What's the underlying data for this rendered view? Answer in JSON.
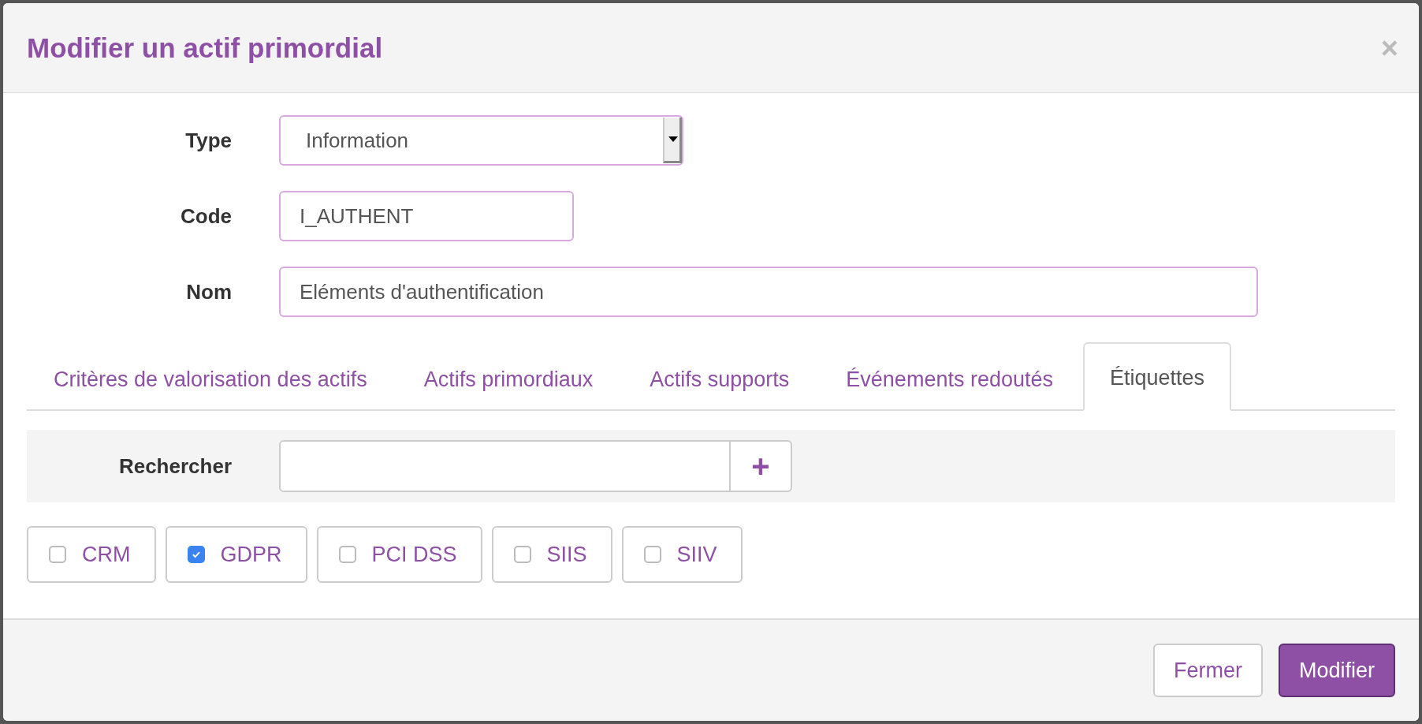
{
  "dialog": {
    "title": "Modifier un actif primordial",
    "close": "×"
  },
  "form": [
    {
      "kind": "select",
      "label": "Type",
      "value": "Information"
    },
    {
      "kind": "short",
      "label": "Code",
      "value": "I_AUTHENT"
    },
    {
      "kind": "long",
      "label": "Nom",
      "value": "Eléments d'authentification"
    }
  ],
  "tabs": [
    {
      "label": "Critères de valorisation des actifs",
      "selected": false
    },
    {
      "label": "Actifs primordiaux",
      "selected": false
    },
    {
      "label": "Actifs supports",
      "selected": false
    },
    {
      "label": "Événements redoutés",
      "selected": false
    },
    {
      "label": "Étiquettes",
      "selected": true
    }
  ],
  "search": {
    "label": "Rechercher",
    "add": "+"
  },
  "tags": [
    {
      "label": "CRM",
      "checked": false
    },
    {
      "label": "GDPR",
      "checked": true
    },
    {
      "label": "PCI DSS",
      "checked": false
    },
    {
      "label": "SIIS",
      "checked": false
    },
    {
      "label": "SIIV",
      "checked": false
    }
  ],
  "buttons": [
    {
      "label": "Fermer",
      "kind": "default"
    },
    {
      "label": "Modifier",
      "kind": "primary"
    }
  ]
}
